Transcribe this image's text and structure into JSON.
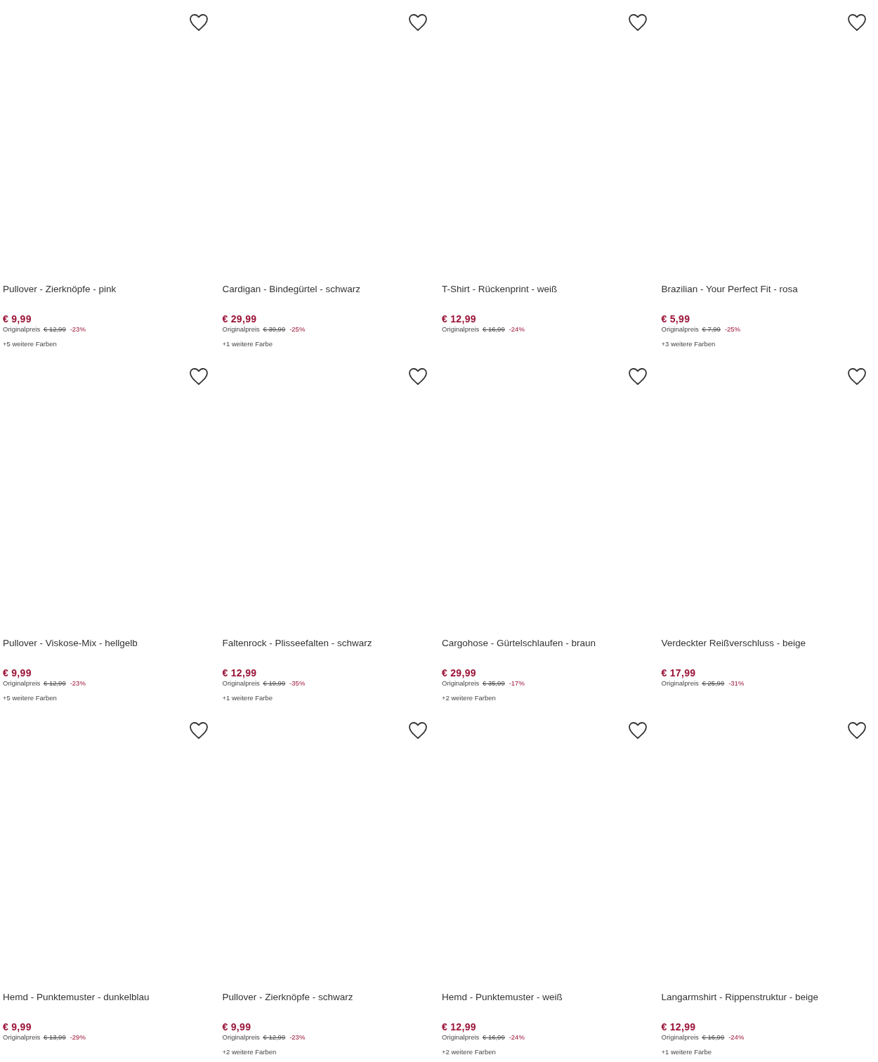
{
  "products": [
    {
      "title": "Pullover - Zierknöpfe - pink",
      "price": "€ 9,99",
      "original_label": "Originalpreis",
      "original_price": "€ 12,99",
      "discount": "-23%",
      "more_colors": "+5 weitere Farben"
    },
    {
      "title": "Cardigan - Bindegürtel - schwarz",
      "price": "€ 29,99",
      "original_label": "Originalpreis",
      "original_price": "€ 39,99",
      "discount": "-25%",
      "more_colors": "+1 weitere Farbe"
    },
    {
      "title": "T-Shirt - Rückenprint - weiß",
      "price": "€ 12,99",
      "original_label": "Originalpreis",
      "original_price": "€ 16,99",
      "discount": "-24%"
    },
    {
      "title": "Brazilian - Your Perfect Fit - rosa",
      "price": "€ 5,99",
      "original_label": "Originalpreis",
      "original_price": "€ 7,99",
      "discount": "-25%",
      "more_colors": "+3 weitere Farben"
    },
    {
      "title": "Pullover - Viskose-Mix - hellgelb",
      "price": "€ 9,99",
      "original_label": "Originalpreis",
      "original_price": "€ 12,99",
      "discount": "-23%",
      "more_colors": "+5 weitere Farben"
    },
    {
      "title": "Faltenrock - Plisseefalten - schwarz",
      "price": "€ 12,99",
      "original_label": "Originalpreis",
      "original_price": "€ 19,99",
      "discount": "-35%",
      "more_colors": "+1 weitere Farbe"
    },
    {
      "title": "Cargohose - Gürtelschlaufen - braun",
      "price": "€ 29,99",
      "original_label": "Originalpreis",
      "original_price": "€ 35,99",
      "discount": "-17%",
      "more_colors": "+2 weitere Farben"
    },
    {
      "title": "Verdeckter Reißverschluss - beige",
      "price": "€ 17,99",
      "original_label": "Originalpreis",
      "original_price": "€ 25,99",
      "discount": "-31%"
    },
    {
      "title": "Hemd - Punktemuster - dunkelblau",
      "price": "€ 9,99",
      "original_label": "Originalpreis",
      "original_price": "€ 13,99",
      "discount": "-29%"
    },
    {
      "title": "Pullover - Zierknöpfe - schwarz",
      "price": "€ 9,99",
      "original_label": "Originalpreis",
      "original_price": "€ 12,99",
      "discount": "-23%",
      "more_colors": "+2 weitere Farben"
    },
    {
      "title": "Hemd - Punktemuster - weiß",
      "price": "€ 12,99",
      "original_label": "Originalpreis",
      "original_price": "€ 16,99",
      "discount": "-24%",
      "more_colors": "+2 weitere Farben"
    },
    {
      "title": "Langarmshirt - Rippenstruktur - beige",
      "price": "€ 12,99",
      "original_label": "Originalpreis",
      "original_price": "€ 16,99",
      "discount": "-24%",
      "more_colors": "+1 weitere Farbe"
    }
  ]
}
